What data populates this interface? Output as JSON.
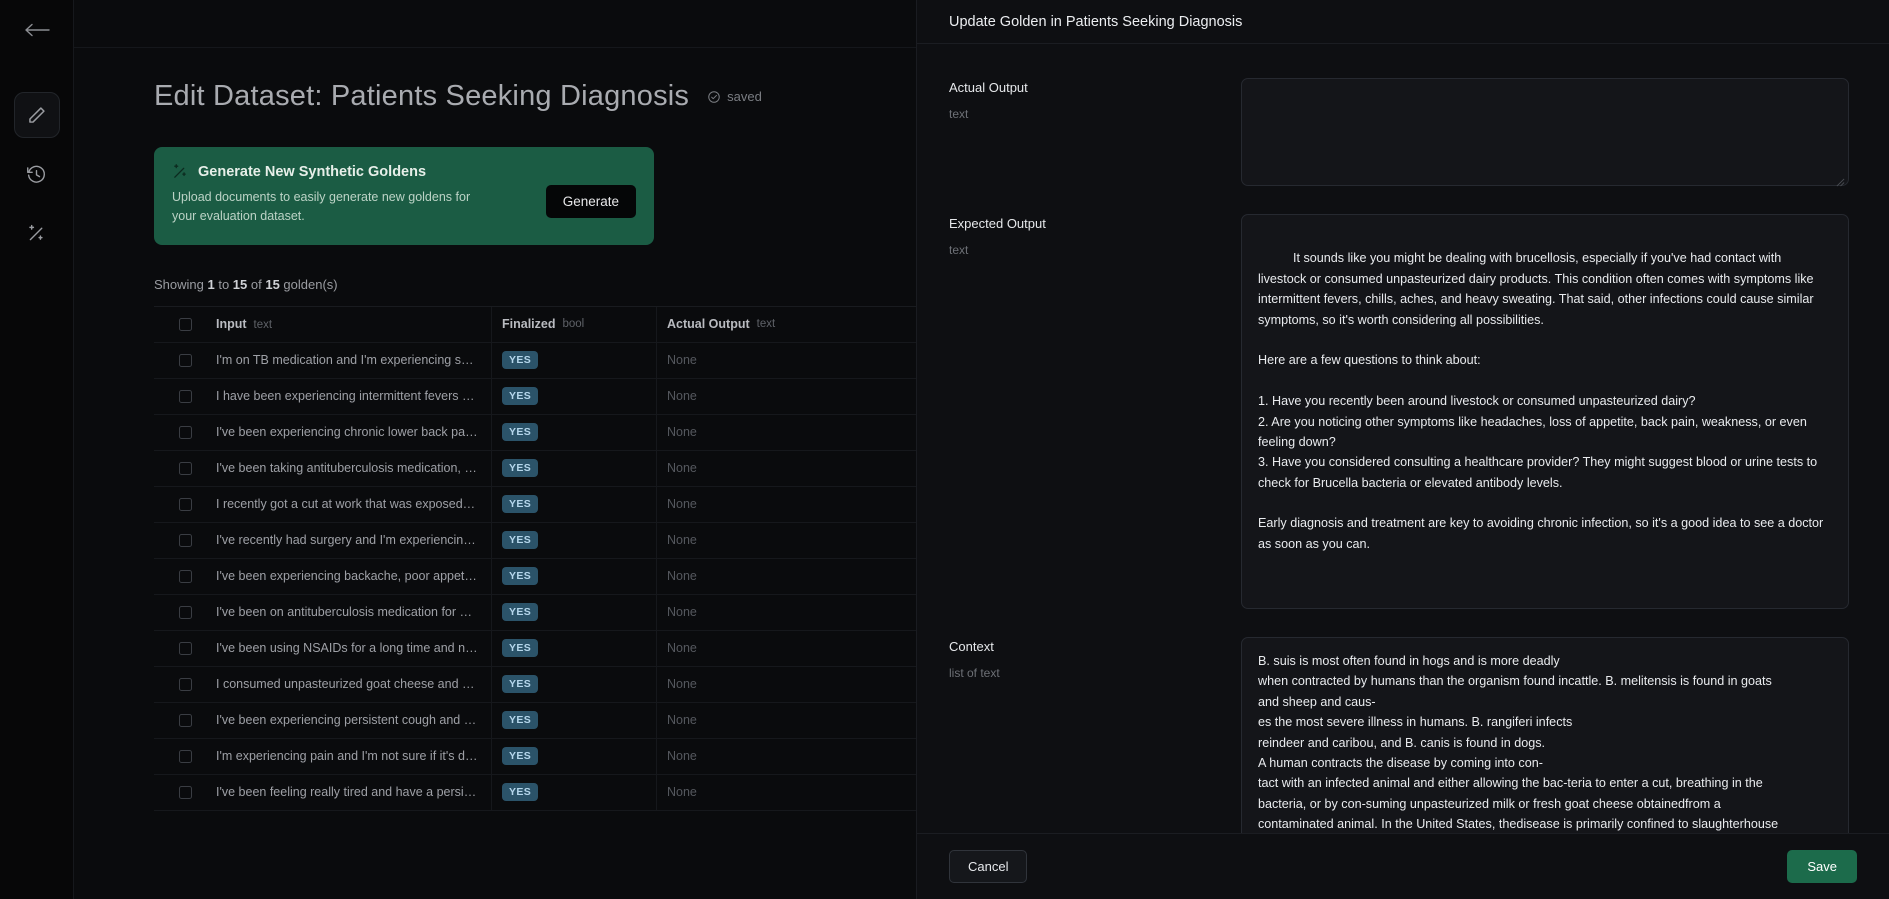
{
  "rail": {
    "back_label": "back-arrow",
    "items": [
      {
        "name": "edit",
        "label": "Edit"
      },
      {
        "name": "history",
        "label": "History"
      },
      {
        "name": "generate",
        "label": "Generate"
      }
    ]
  },
  "main": {
    "page_title": "Edit Dataset: Patients Seeking Diagnosis",
    "saved_label": "saved",
    "generate_card": {
      "title": "Generate New Synthetic Goldens",
      "subtitle": "Upload documents to easily generate new goldens for your evaluation dataset.",
      "button_label": "Generate",
      "bg_color": "#1b5c44"
    },
    "showing": {
      "prefix": "Showing ",
      "from": "1",
      "mid": " to ",
      "to": "15",
      "of": " of ",
      "total": "15",
      "suffix": " golden(s)"
    },
    "table": {
      "columns": [
        {
          "label": "Input",
          "type": "text"
        },
        {
          "label": "Finalized",
          "type": "bool"
        },
        {
          "label": "Actual Output",
          "type": "text"
        }
      ],
      "rows": [
        {
          "input": "I'm on TB medication and I'm experiencing some si…",
          "finalized": "YES",
          "actual": "None"
        },
        {
          "input": "I have been experiencing intermittent fevers and I'…",
          "finalized": "YES",
          "actual": "None"
        },
        {
          "input": "I've been experiencing chronic lower back pain, an…",
          "finalized": "YES",
          "actual": "None"
        },
        {
          "input": "I've been taking antituberculosis medication, but I'…",
          "finalized": "YES",
          "actual": "None"
        },
        {
          "input": "I recently got a cut at work that was exposed to ani…",
          "finalized": "YES",
          "actual": "None"
        },
        {
          "input": "I've recently had surgery and I'm experiencing pain…",
          "finalized": "YES",
          "actual": "None"
        },
        {
          "input": "I've been experiencing backache, poor appetite, an…",
          "finalized": "YES",
          "actual": "None"
        },
        {
          "input": "I've been on antituberculosis medication for a while…",
          "finalized": "YES",
          "actual": "None"
        },
        {
          "input": "I've been using NSAIDs for a long time and now I'…",
          "finalized": "YES",
          "actual": "None"
        },
        {
          "input": "I consumed unpasteurized goat cheese and now I'…",
          "finalized": "YES",
          "actual": "None"
        },
        {
          "input": "I've been experiencing persistent cough and fatigu…",
          "finalized": "YES",
          "actual": "None"
        },
        {
          "input": "I'm experiencing pain and I'm not sure if it's due to …",
          "finalized": "YES",
          "actual": "None"
        },
        {
          "input": "I've been feeling really tired and have a persistent …",
          "finalized": "YES",
          "actual": "None"
        }
      ]
    }
  },
  "drawer": {
    "title": "Update Golden in Patients Seeking Diagnosis",
    "fields": {
      "actual_output": {
        "label": "Actual Output",
        "type": "text",
        "value": "",
        "placeholder": ""
      },
      "expected_output": {
        "label": "Expected Output",
        "type": "text",
        "value": "It sounds like you might be dealing with brucellosis, especially if you've had contact with livestock or consumed unpasteurized dairy products. This condition often comes with symptoms like intermittent fevers, chills, aches, and heavy sweating. That said, other infections could cause similar symptoms, so it's worth considering all possibilities.\n\nHere are a few questions to think about:\n\n1. Have you recently been around livestock or consumed unpasteurized dairy?\n2. Are you noticing other symptoms like headaches, loss of appetite, back pain, weakness, or even feeling down?\n3. Have you considered consulting a healthcare provider? They might suggest blood or urine tests to check for Brucella bacteria or elevated antibody levels.\n\nEarly diagnosis and treatment are key to avoiding chronic infection, so it's a good idea to see a doctor as soon as you can."
      },
      "context": {
        "label": "Context",
        "type": "list of text",
        "value": "B. suis is most often found in hogs and is more deadly\nwhen contracted by humans than the organism found incattle. B. melitensis is found in goats\nand sheep and caus-\nes the most severe illness in humans. B. rangiferi infects\nreindeer and caribou, and B. canis is found in dogs.\nA human contracts the disease by coming into con-\ntact with an infected animal and either allowing the bac-teria to enter a cut, breathing in the\nbacteria, or by con-suming unpasteurized milk or fresh goat cheese obtainedfrom a\ncontaminated animal. In the United States, thedisease is primarily confined to slaughterhouse"
      }
    },
    "footer": {
      "cancel_label": "Cancel",
      "save_label": "Save",
      "save_color": "#1c6b4b"
    }
  }
}
